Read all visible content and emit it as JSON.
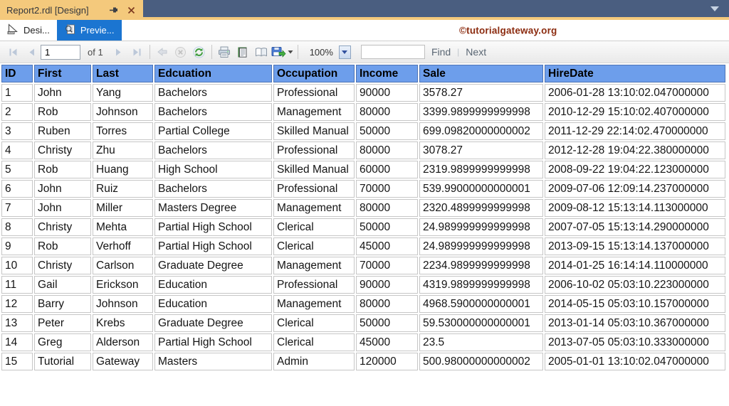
{
  "window": {
    "tab_title": "Report2.rdl [Design]"
  },
  "doc_tabs": {
    "design_label": "Desi...",
    "preview_label": "Previe...",
    "watermark": "©tutorialgateway.org"
  },
  "toolbar": {
    "page_number": "1",
    "of_label": "of 1",
    "zoom_value": "100%",
    "find_value": "",
    "find_label": "Find",
    "next_label": "Next"
  },
  "report_table": {
    "columns": [
      "ID",
      "First",
      "Last",
      "Edcuation",
      "Occupation",
      "Income",
      "Sale",
      "HireDate"
    ],
    "rows": [
      [
        "1",
        "John",
        "Yang",
        "Bachelors",
        "Professional",
        "90000",
        "3578.27",
        "2006-01-28 13:10:02.047000000"
      ],
      [
        "2",
        "Rob",
        "Johnson",
        "Bachelors",
        "Management",
        "80000",
        "3399.9899999999998",
        "2010-12-29 15:10:02.407000000"
      ],
      [
        "3",
        "Ruben",
        "Torres",
        "Partial College",
        "Skilled Manual",
        "50000",
        "699.09820000000002",
        "2011-12-29 22:14:02.470000000"
      ],
      [
        "4",
        "Christy",
        "Zhu",
        "Bachelors",
        "Professional",
        "80000",
        "3078.27",
        "2012-12-28 19:04:22.380000000"
      ],
      [
        "5",
        "Rob",
        "Huang",
        "High School",
        "Skilled Manual",
        "60000",
        "2319.9899999999998",
        "2008-09-22 19:04:22.123000000"
      ],
      [
        "6",
        "John",
        "Ruiz",
        "Bachelors",
        "Professional",
        "70000",
        "539.99000000000001",
        "2009-07-06 12:09:14.237000000"
      ],
      [
        "7",
        "John",
        "Miller",
        "Masters Degree",
        "Management",
        "80000",
        "2320.4899999999998",
        "2009-08-12 15:13:14.113000000"
      ],
      [
        "8",
        "Christy",
        "Mehta",
        "Partial High School",
        "Clerical",
        "50000",
        "24.989999999999998",
        "2007-07-05 15:13:14.290000000"
      ],
      [
        "9",
        "Rob",
        "Verhoff",
        "Partial High School",
        "Clerical",
        "45000",
        "24.989999999999998",
        "2013-09-15 15:13:14.137000000"
      ],
      [
        "10",
        "Christy",
        "Carlson",
        "Graduate Degree",
        "Management",
        "70000",
        "2234.9899999999998",
        "2014-01-25 16:14:14.110000000"
      ],
      [
        "11",
        "Gail",
        "Erickson",
        "Education",
        "Professional",
        "90000",
        "4319.9899999999998",
        "2006-10-02 05:03:10.223000000"
      ],
      [
        "12",
        "Barry",
        "Johnson",
        "Education",
        "Management",
        "80000",
        "4968.5900000000001",
        "2014-05-15 05:03:10.157000000"
      ],
      [
        "13",
        "Peter",
        "Krebs",
        "Graduate Degree",
        "Clerical",
        "50000",
        "59.530000000000001",
        "2013-01-14 05:03:10.367000000"
      ],
      [
        "14",
        "Greg",
        "Alderson",
        "Partial High School",
        "Clerical",
        "45000",
        "23.5",
        "2013-07-05 05:03:10.333000000"
      ],
      [
        "15",
        "Tutorial",
        "Gateway",
        "Masters",
        "Admin",
        "120000",
        "500.98000000000002",
        "2005-01-01 13:10:02.047000000"
      ]
    ]
  },
  "colors": {
    "titlebar_bg": "#4A5E80",
    "active_doc_tab_bg": "#F4C97C",
    "preview_tab_bg": "#1B75D1",
    "table_header_bg": "#6D9EEB",
    "watermark_color": "#8B2B0F"
  }
}
